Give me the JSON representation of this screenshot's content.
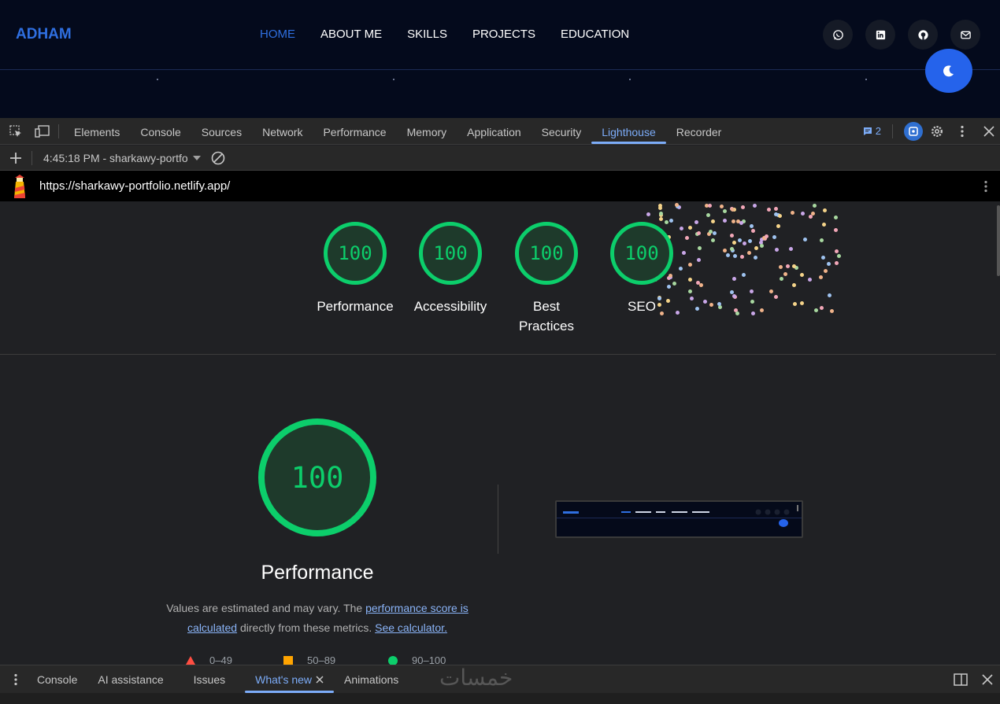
{
  "site": {
    "logo": "ADHAM",
    "nav": [
      "HOME",
      "ABOUT ME",
      "SKILLS",
      "PROJECTS",
      "EDUCATION"
    ],
    "active_nav": "HOME",
    "social_icons": [
      "whatsapp-icon",
      "linkedin-icon",
      "github-icon",
      "mail-icon"
    ],
    "accent": "#2f6fe0",
    "background": "#040a1c"
  },
  "devtools": {
    "tabs": [
      "Elements",
      "Console",
      "Sources",
      "Network",
      "Performance",
      "Memory",
      "Application",
      "Security",
      "Lighthouse",
      "Recorder"
    ],
    "active_tab": "Lighthouse",
    "issues_count": "2",
    "report_selector": "4:45:18 PM - sharkawy-portfo",
    "url": "https://sharkawy-portfolio.netlify.app/"
  },
  "report": {
    "scores": [
      {
        "value": "100",
        "label": "Performance"
      },
      {
        "value": "100",
        "label": "Accessibility"
      },
      {
        "value": "100",
        "label": "Best Practices"
      },
      {
        "value": "100",
        "label": "SEO"
      }
    ],
    "main_score": "100",
    "main_title": "Performance",
    "desc_prefix": "Values are estimated and may vary. The ",
    "desc_link1": "performance score is calculated",
    "desc_middle": " directly from these metrics. ",
    "desc_link2": "See calculator.",
    "legend": [
      {
        "range": "0–49",
        "color": "#ff4e42"
      },
      {
        "range": "50–89",
        "color": "#ffa400"
      },
      {
        "range": "90–100",
        "color": "#0cce6b"
      }
    ],
    "pass_color": "#0cce6b"
  },
  "drawer": {
    "tabs": [
      "Console",
      "AI assistance",
      "Issues",
      "What's new",
      "Animations"
    ],
    "active_tab": "What's new"
  },
  "watermark": "خمسات"
}
